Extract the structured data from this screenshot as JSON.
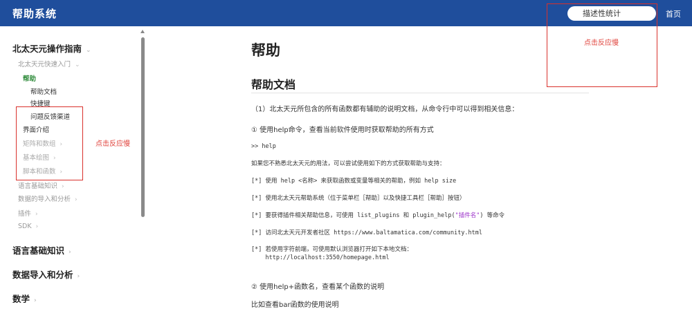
{
  "header": {
    "app_title": "帮助系统",
    "search_value": "描述性统计",
    "home_label": "首页"
  },
  "sidebar": {
    "section_main": "北太天元操作指南",
    "quickstart": "北太天元快速入门",
    "help": "帮助",
    "help_docs": "帮助文档",
    "shortcuts": "快捷键",
    "feedback": "问题反馈渠道",
    "ui_intro": "界面介绍",
    "matrix": "矩阵和数组",
    "basic_plot": "基本绘图",
    "scripts": "脚本和函数",
    "lang_basics_sub": "语言基础知识",
    "data_io_sub": "数据的导入和分析",
    "plugins": "插件",
    "sdk": "SDK",
    "lang_basics": "语言基础知识",
    "data_io": "数据导入和分析",
    "math": "数学"
  },
  "annotations": {
    "left_note": "点击反应慢",
    "right_note": "点击反应慢"
  },
  "content": {
    "title": "帮助",
    "subtitle": "帮助文档",
    "p1": "（1）北太天元所包含的所有函数都有辅助的说明文档，从命令行中可以得到相关信息：",
    "p2": "①  使用help命令，查看当前软件使用时获取帮助的所有方式",
    "code1": ">> help",
    "p3": "如果您不熟悉北太天元的用法，可以尝试使用如下的方式获取帮助与支持：",
    "b1": "[*] 使用 help <名称> 来获取函数或变量等相关的帮助，例如 help size",
    "b2": "[*] 使用北太天元帮助系统（位于菜单栏［帮助］以及快捷工具栏［帮助］按钮）",
    "b3_pre": "[*] 要获得插件相关帮助信息，可使用 list_plugins 和 plugin_help(",
    "b3_str": "\"插件名\"",
    "b3_post": ") 等命令",
    "b4": "[*] 访问北太天元开发者社区 https://www.baltamatica.com/community.html",
    "b5a": "[*] 若使用字符前端，可使用默认浏览器打开如下本地文档：",
    "b5b": "    http://localhost:3550/homepage.html",
    "p4": "②  使用help+函数名，查看某个函数的说明",
    "p5": "比如查看bar函数的使用说明"
  },
  "colors": {
    "header_bg": "#1f4e9c",
    "active_nav": "#2e8b3a",
    "annotation": "#d9302b"
  }
}
